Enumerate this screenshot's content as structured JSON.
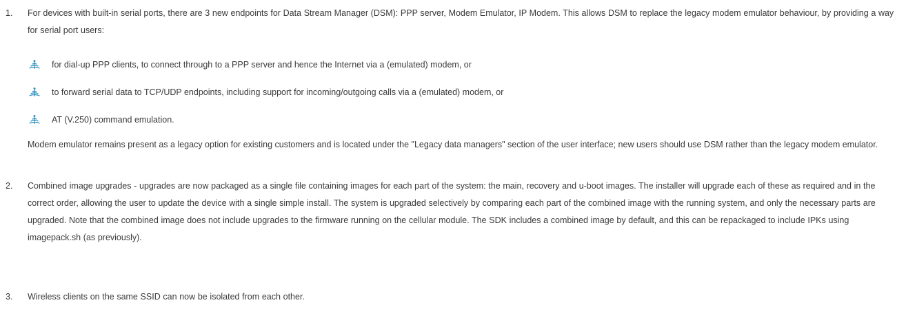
{
  "items": [
    {
      "number": "1.",
      "text": "For devices with built-in serial ports, there are 3 new endpoints for Data Stream Manager (DSM): PPP server, Modem Emulator, IP Modem. This allows DSM to replace the legacy modem emulator behaviour, by providing a way for serial port users:",
      "bullets": [
        "for dial-up PPP clients, to connect through to a PPP server and hence the Internet via a (emulated) modem, or",
        "to forward serial data to TCP/UDP endpoints, including support for incoming/outgoing calls via a (emulated) modem, or",
        "AT (V.250) command emulation."
      ],
      "note": "Modem emulator remains present as a legacy option for existing customers and is located under the \"Legacy data managers\" section of the user interface; new users should use DSM rather than the legacy modem emulator."
    },
    {
      "number": "2.",
      "text": "Combined image upgrades - upgrades are now packaged as a single file containing images for each part of the system: the main, recovery and u-boot images. The installer will upgrade each of these as required and in the correct order, allowing the user to update the device with a single simple install. The system is upgraded selectively by comparing each part of the combined image with the running system, and only the necessary parts are upgraded. Note that the combined image does not include upgrades to the firmware running on the cellular module. The SDK includes a combined image by default, and this can be repackaged to include IPKs using imagepack.sh (as previously)."
    },
    {
      "number": "3.",
      "text": "Wireless clients on the same SSID can now be isolated from each other."
    }
  ],
  "colors": {
    "text": "#3a3a3a",
    "bullet_icon": "#2a8fc4"
  },
  "bullet_icon_name": "wifi-signal-icon"
}
